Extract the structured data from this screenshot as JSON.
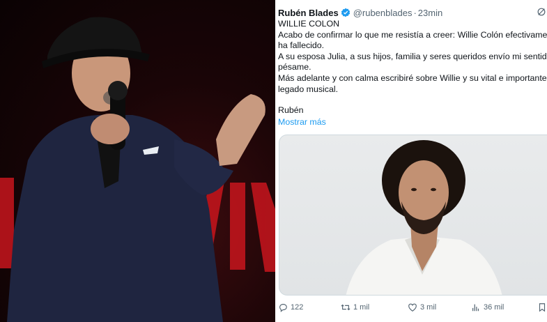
{
  "tweet": {
    "author_name": "Rubén Blades",
    "handle": "@rubenblades",
    "separator": "·",
    "time": "23min",
    "lines": [
      "WILLIE COLON",
      "Acabo de confirmar lo que me resistía a creer: Willie Colón efectivamente",
      "ha fallecido.",
      "A su esposa Julia, a sus hijos, familia y seres queridos envío mi sentido",
      "pésame.",
      "Más adelante y con calma escribiré sobre Willie y su vital e importante",
      "legado musical."
    ],
    "signature": "Rubén",
    "show_more": "Mostrar más",
    "stats": {
      "replies": "122",
      "retweets": "1 mil",
      "likes": "3 mil",
      "views": "36 mil"
    }
  },
  "colors": {
    "link": "#1d9bf0",
    "text": "#0f1419",
    "muted": "#536471",
    "stage_red": "#c8151d"
  },
  "icons": [
    "verified-badge-icon",
    "grok-icon",
    "reply-icon",
    "retweet-icon",
    "like-icon",
    "views-icon",
    "bookmark-icon"
  ]
}
